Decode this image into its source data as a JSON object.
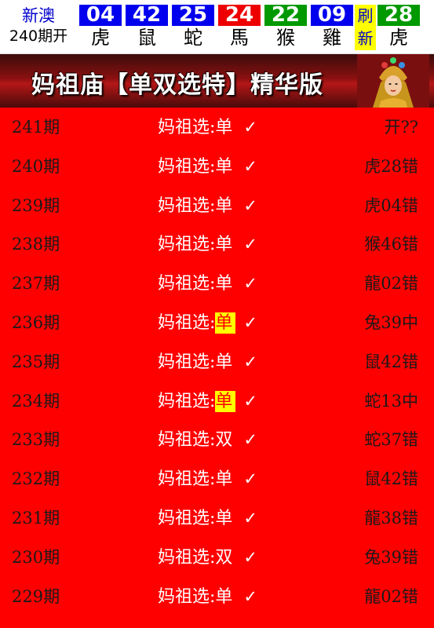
{
  "header": {
    "region": "新澳",
    "issue": "240期开",
    "balls": [
      {
        "num": "04",
        "zodiac": "虎",
        "color": "#0000ee"
      },
      {
        "num": "42",
        "zodiac": "鼠",
        "color": "#0000ee"
      },
      {
        "num": "25",
        "zodiac": "蛇",
        "color": "#0000ee"
      },
      {
        "num": "24",
        "zodiac": "馬",
        "color": "#ee0000"
      },
      {
        "num": "22",
        "zodiac": "猴",
        "color": "#009900"
      },
      {
        "num": "09",
        "zodiac": "雞",
        "color": "#0000ee"
      }
    ],
    "refresh": [
      "刷",
      "新"
    ],
    "special": {
      "num": "28",
      "zodiac": "虎",
      "color": "#009900"
    }
  },
  "banner": {
    "title": "妈祖庙【单双选特】精华版"
  },
  "rows": [
    {
      "period": "241期",
      "label": "妈祖选:",
      "pick": "单",
      "check": "✓",
      "result": "开??",
      "hit": false
    },
    {
      "period": "240期",
      "label": "妈祖选:",
      "pick": "单",
      "check": "✓",
      "result": "虎28错",
      "hit": false
    },
    {
      "period": "239期",
      "label": "妈祖选:",
      "pick": "单",
      "check": "✓",
      "result": "虎04错",
      "hit": false
    },
    {
      "period": "238期",
      "label": "妈祖选:",
      "pick": "单",
      "check": "✓",
      "result": "猴46错",
      "hit": false
    },
    {
      "period": "237期",
      "label": "妈祖选:",
      "pick": "单",
      "check": "✓",
      "result": "龍02错",
      "hit": false
    },
    {
      "period": "236期",
      "label": "妈祖选:",
      "pick": "单",
      "check": "✓",
      "result": "兔39中",
      "hit": true
    },
    {
      "period": "235期",
      "label": "妈祖选:",
      "pick": "单",
      "check": "✓",
      "result": "鼠42错",
      "hit": false
    },
    {
      "period": "234期",
      "label": "妈祖选:",
      "pick": "单",
      "check": "✓",
      "result": "蛇13中",
      "hit": true
    },
    {
      "period": "233期",
      "label": "妈祖选:",
      "pick": "双",
      "check": "✓",
      "result": "蛇37错",
      "hit": false
    },
    {
      "period": "232期",
      "label": "妈祖选:",
      "pick": "单",
      "check": "✓",
      "result": "鼠42错",
      "hit": false
    },
    {
      "period": "231期",
      "label": "妈祖选:",
      "pick": "单",
      "check": "✓",
      "result": "龍38错",
      "hit": false
    },
    {
      "period": "230期",
      "label": "妈祖选:",
      "pick": "双",
      "check": "✓",
      "result": "兔39错",
      "hit": false
    },
    {
      "period": "229期",
      "label": "妈祖选:",
      "pick": "单",
      "check": "✓",
      "result": "龍02错",
      "hit": false
    }
  ]
}
